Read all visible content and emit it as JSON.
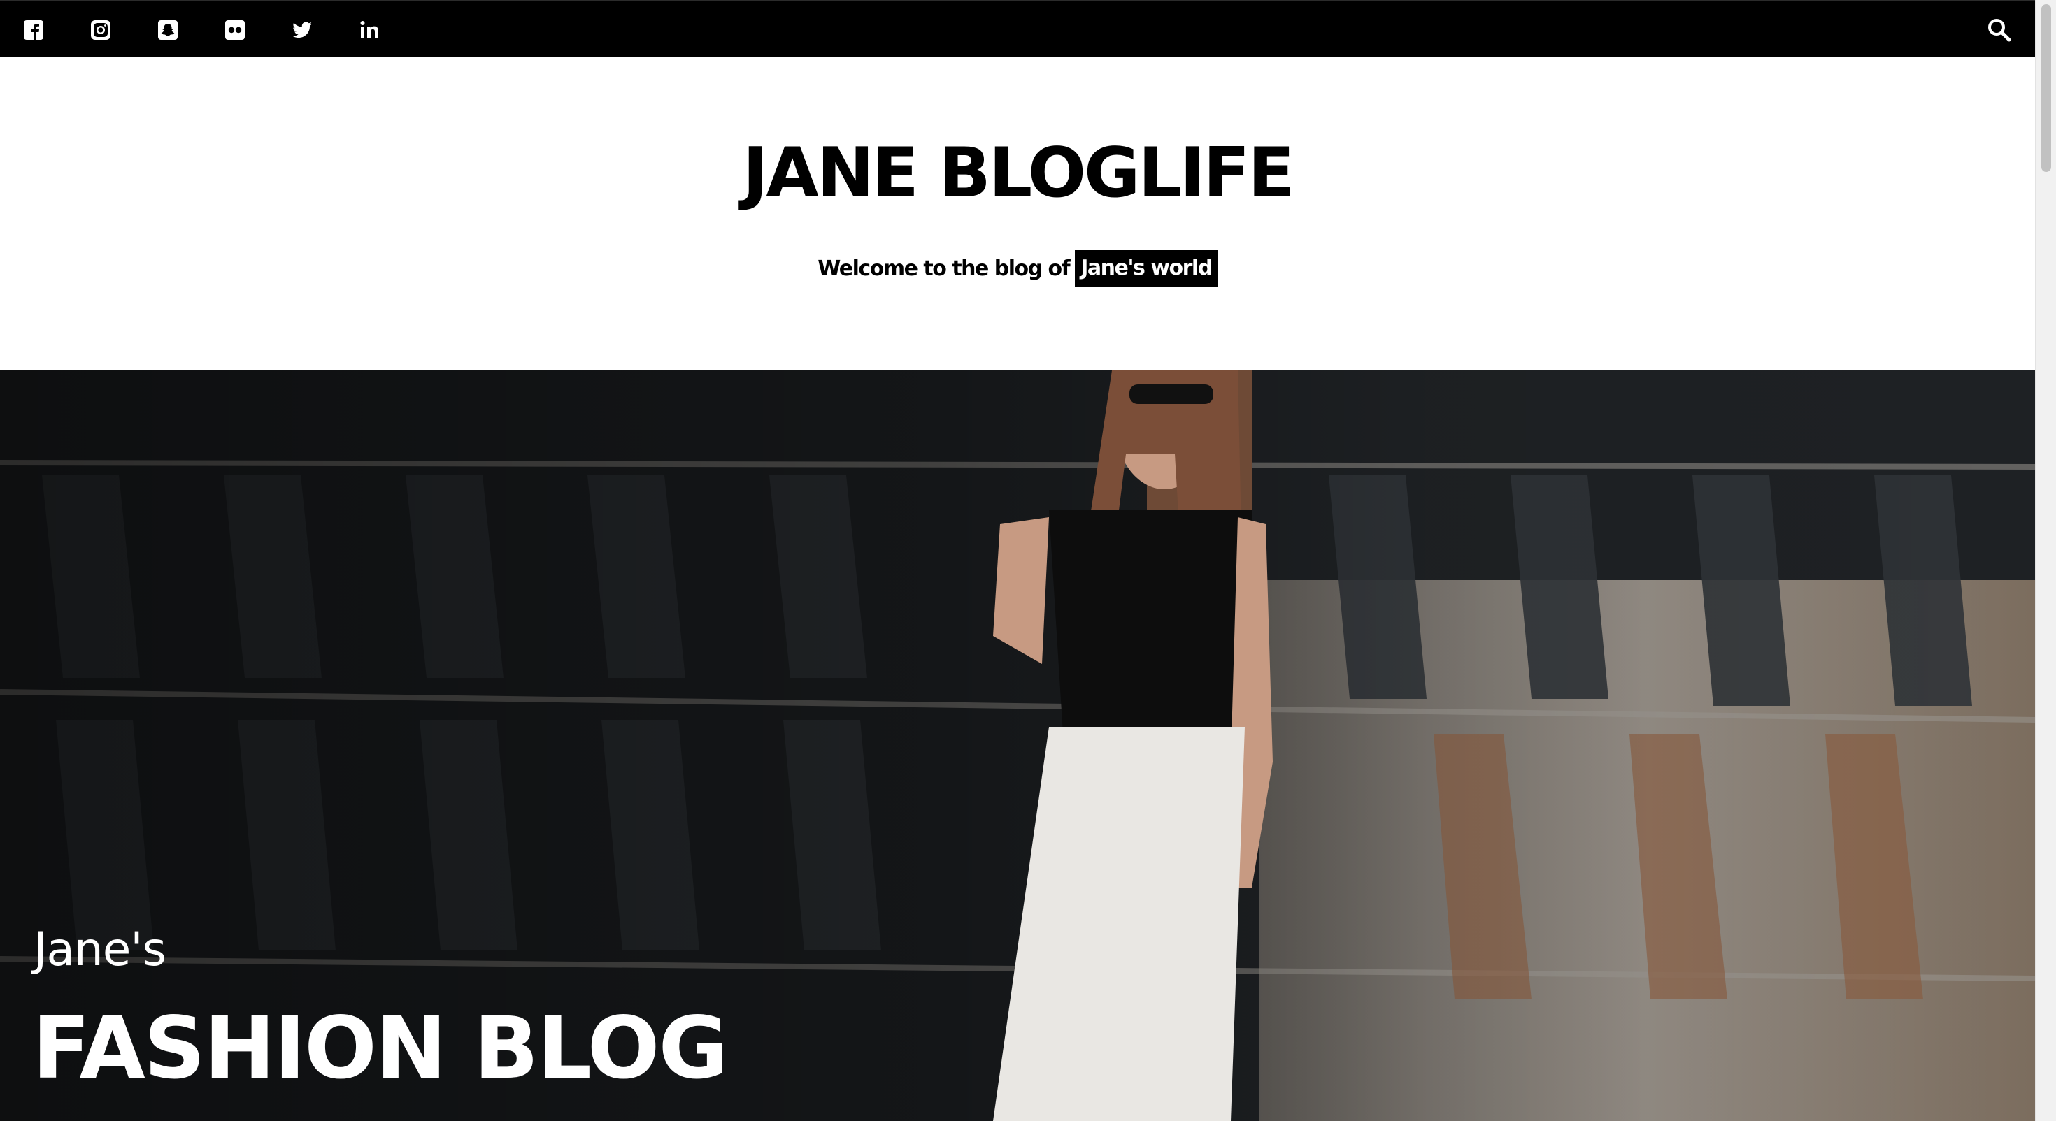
{
  "social": {
    "items": [
      {
        "name": "facebook-icon"
      },
      {
        "name": "instagram-icon"
      },
      {
        "name": "snapchat-icon"
      },
      {
        "name": "flickr-icon"
      },
      {
        "name": "twitter-icon"
      },
      {
        "name": "linkedin-icon"
      }
    ],
    "search_icon": "search-icon"
  },
  "header": {
    "site_title": "JANE BLOGLIFE",
    "tagline_prefix": "Welcome to the blog of",
    "tagline_highlight": "Jane's world"
  },
  "hero": {
    "subtitle": "Jane's",
    "title": "FASHION BLOG"
  },
  "colors": {
    "topbar_bg": "#000000",
    "text": "#000000",
    "highlight_bg": "#000000",
    "highlight_text": "#ffffff"
  }
}
